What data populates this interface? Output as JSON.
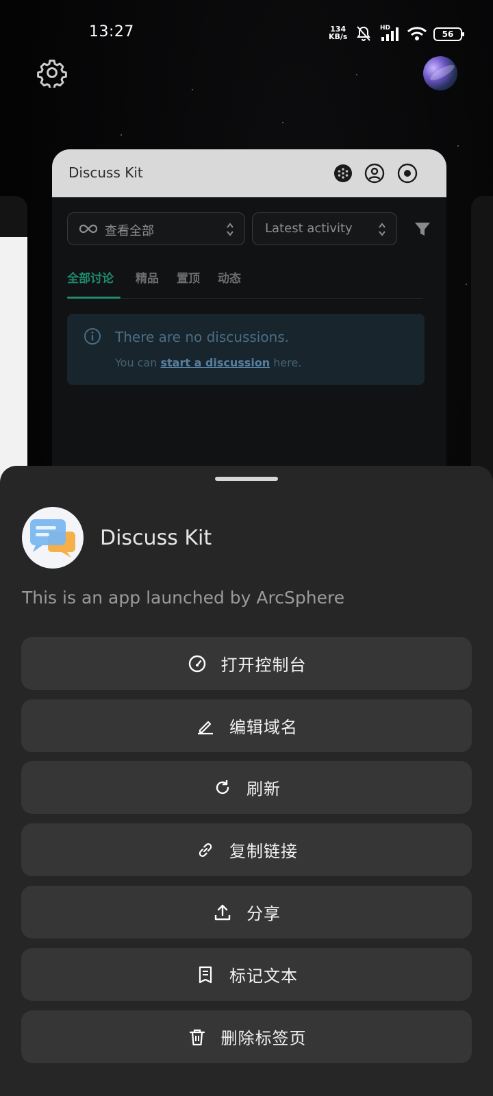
{
  "status_bar": {
    "time": "13:27",
    "net_speed_value": "134",
    "net_speed_unit": "KB/s",
    "network_type": "HD",
    "battery": "56"
  },
  "preview_card": {
    "title": "Discuss Kit",
    "filter_all": "查看全部",
    "sort": "Latest activity",
    "tabs": [
      {
        "label": "全部讨论",
        "active": true
      },
      {
        "label": "精品",
        "active": false
      },
      {
        "label": "置顶",
        "active": false
      },
      {
        "label": "动态",
        "active": false
      }
    ],
    "alert": {
      "title": "There are no discussions.",
      "text_before": "You can ",
      "link": "start a discussion",
      "text_after": " here."
    }
  },
  "sheet": {
    "app_name": "Discuss Kit",
    "description": "This is an app launched by ArcSphere",
    "actions": [
      {
        "label": "打开控制台",
        "icon": "dashboard-icon"
      },
      {
        "label": "编辑域名",
        "icon": "edit-icon"
      },
      {
        "label": "刷新",
        "icon": "refresh-icon"
      },
      {
        "label": "复制链接",
        "icon": "link-icon"
      },
      {
        "label": "分享",
        "icon": "share-icon"
      },
      {
        "label": "标记文本",
        "icon": "note-icon"
      },
      {
        "label": "删除标签页",
        "icon": "trash-icon"
      }
    ]
  },
  "colors": {
    "sheet_bg": "#262626",
    "button_bg": "#363636",
    "accent": "#1f8a6c"
  }
}
